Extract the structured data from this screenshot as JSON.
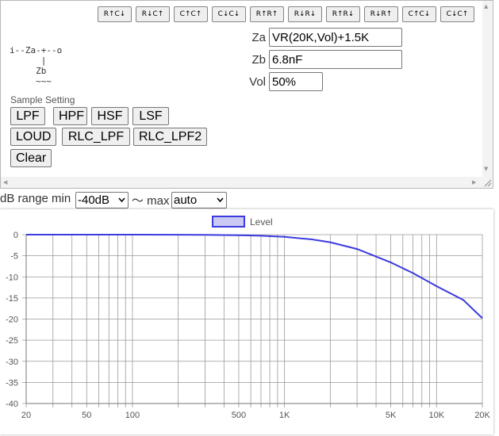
{
  "toolbar": {
    "buttons": [
      "R↑C↓",
      "R↓C↑",
      "C↑C↑",
      "C↓C↓",
      "R↑R↑",
      "R↓R↓",
      "R↑R↓",
      "R↓R↑",
      "C↑C↓",
      "C↓C↑"
    ]
  },
  "circuit": {
    "line1": "i--Za-+--o",
    "line2": "      |",
    "line3": "     Zb",
    "line4": "     ~~~"
  },
  "fields": {
    "za_label": "Za",
    "za_value": "VR(20K,Vol)+1.5K",
    "zb_label": "Zb",
    "zb_value": "6.8nF",
    "vol_label": "Vol",
    "vol_value": "50%"
  },
  "sample": {
    "label": "Sample Setting",
    "buttons": [
      "LPF",
      "HPF",
      "HSF",
      "LSF",
      "LOUD",
      "RLC_LPF",
      "RLC_LPF2",
      "Clear"
    ]
  },
  "range": {
    "min_label": "dB range min",
    "min_value": "-40dB",
    "separator": "〜 max",
    "max_value": "auto"
  },
  "chart_data": {
    "type": "line",
    "legend": "Level",
    "legend_position": "top-center",
    "grid": true,
    "xscale": "log",
    "xlim": [
      20,
      20000
    ],
    "ylim": [
      -40,
      0
    ],
    "x_ticks": [
      "20",
      "50",
      "100",
      "500",
      "1K",
      "5K",
      "10K",
      "20K"
    ],
    "y_ticks": [
      "0",
      "-5",
      "-10",
      "-15",
      "-20",
      "-25",
      "-30",
      "-35",
      "-40"
    ],
    "series": [
      {
        "name": "Level",
        "color": "#3b3bdf",
        "x": [
          20,
          50,
          100,
          200,
          300,
          500,
          700,
          1000,
          1500,
          2000,
          3000,
          5000,
          7000,
          10000,
          15000,
          20000
        ],
        "y": [
          0,
          0,
          0,
          -0.02,
          -0.05,
          -0.14,
          -0.27,
          -0.53,
          -1.1,
          -1.8,
          -3.4,
          -6.6,
          -9.1,
          -12.2,
          -15.5,
          -19.8
        ]
      }
    ]
  }
}
